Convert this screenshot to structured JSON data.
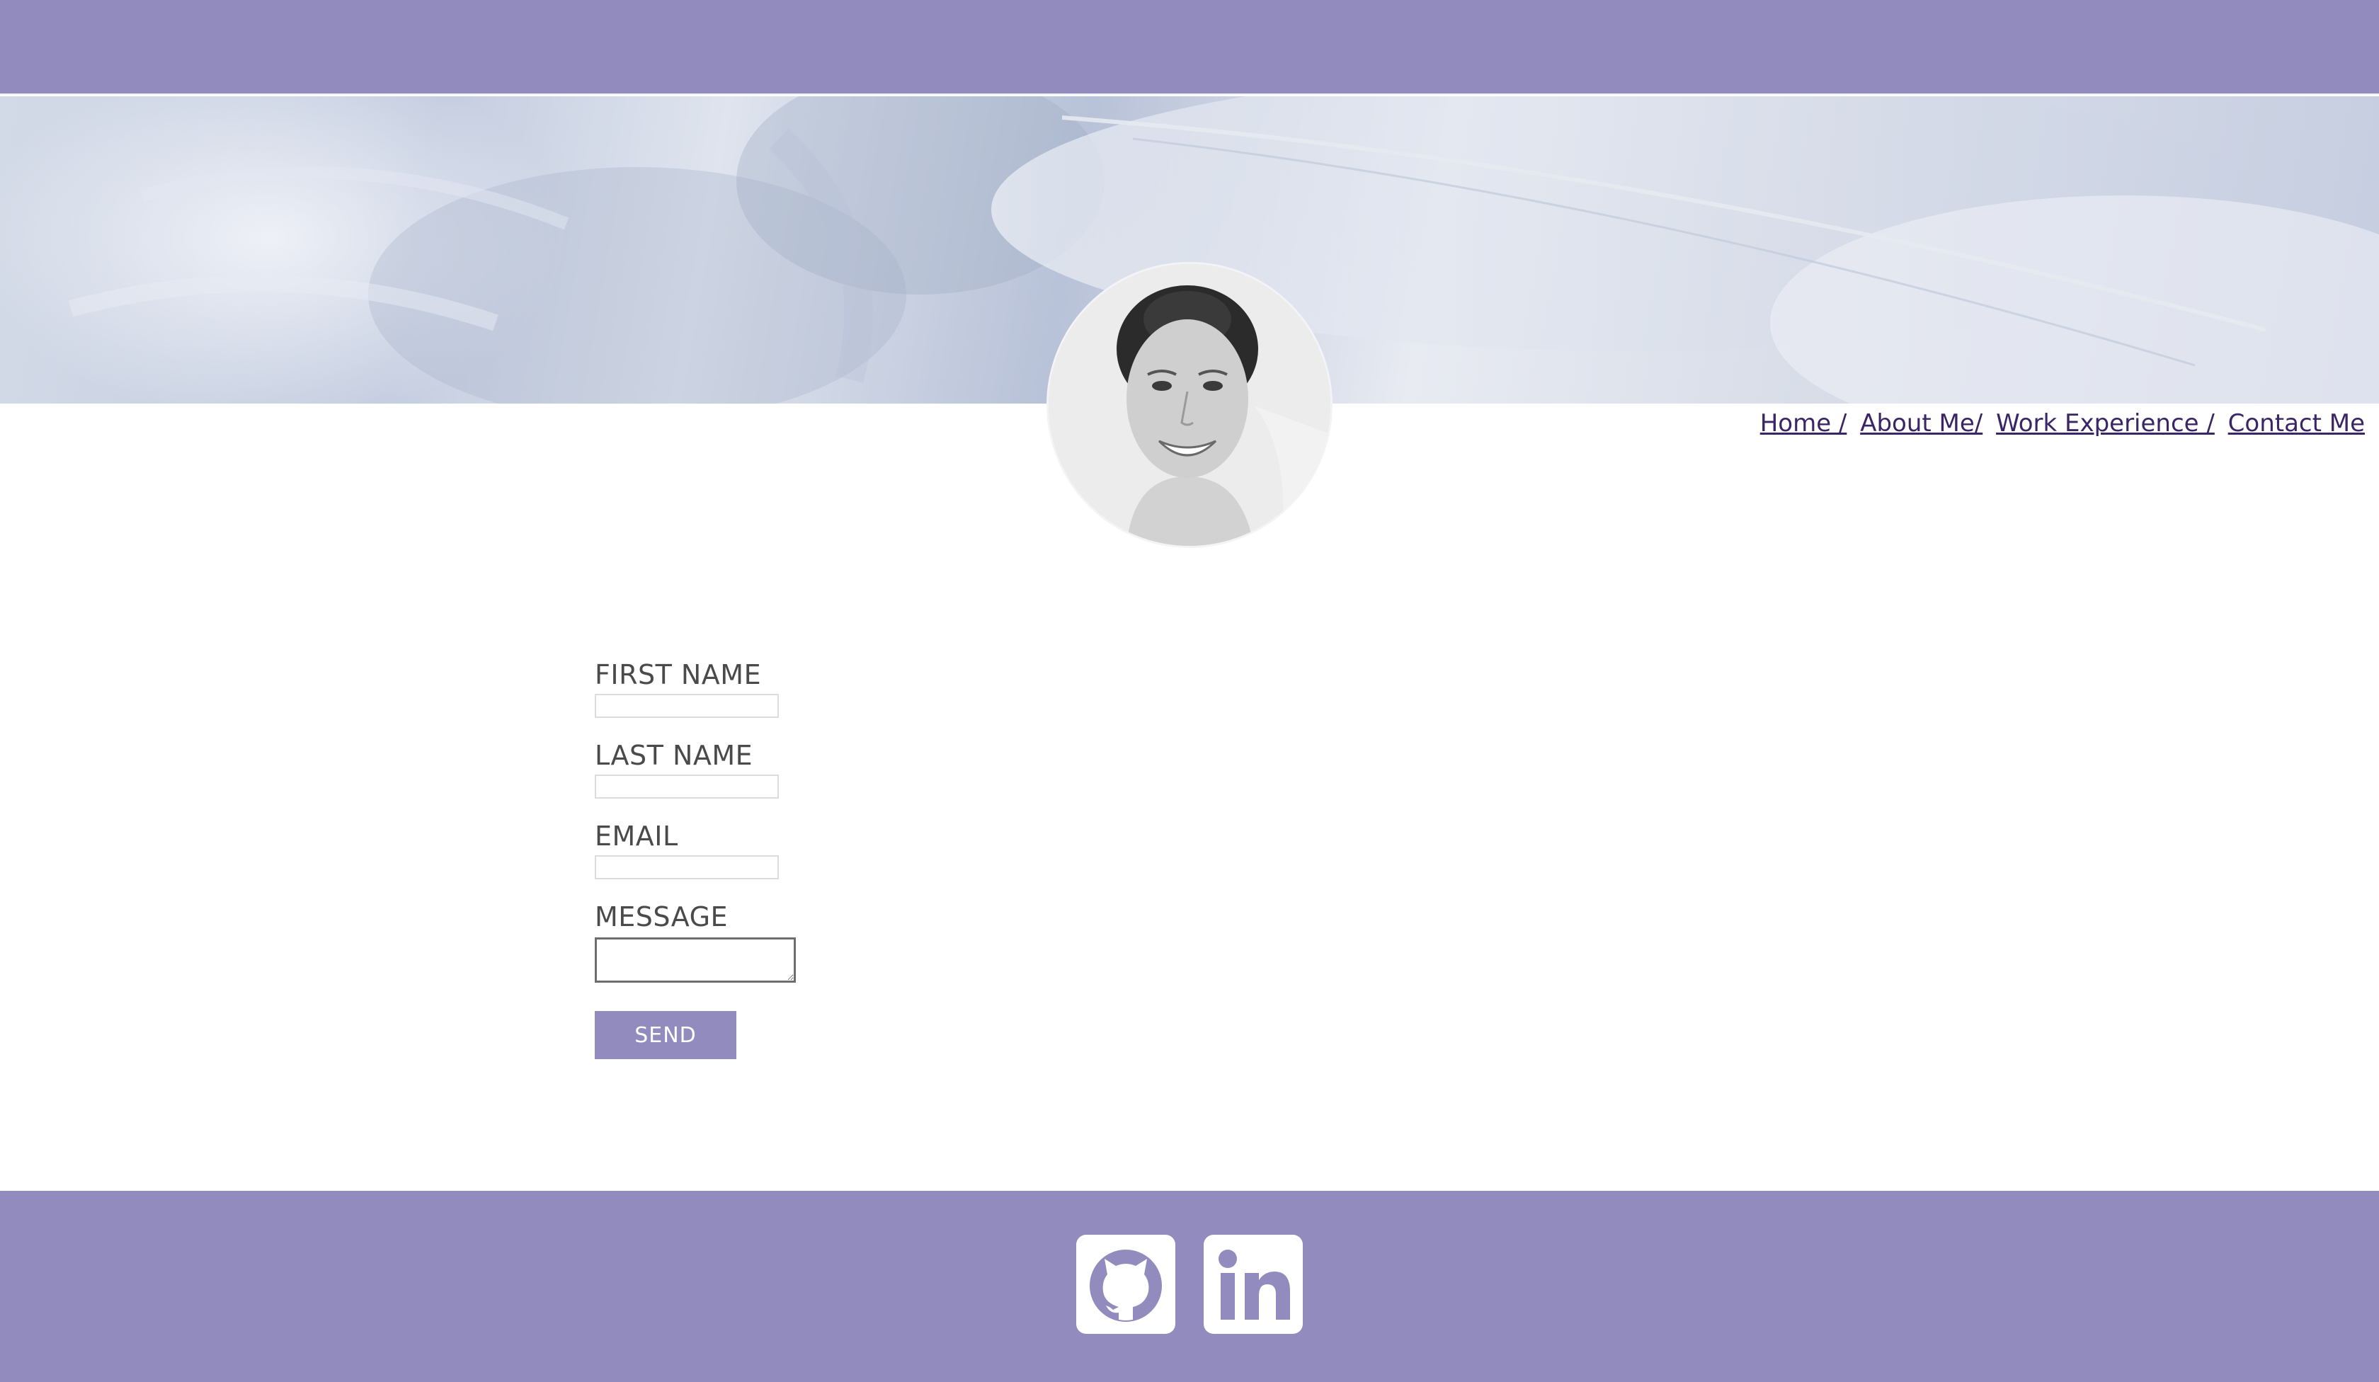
{
  "colors": {
    "accent": "#928bbe",
    "nav_link": "#3a2566",
    "label_text": "#4a4a4a",
    "page_bg": "#ffffff"
  },
  "header": {},
  "hero": {
    "image": "feather-background-image",
    "avatar": "profile-photo"
  },
  "nav": {
    "items": [
      {
        "label": "Home /"
      },
      {
        "label": "About Me/"
      },
      {
        "label": "Work Experience /"
      },
      {
        "label": "Contact Me"
      }
    ]
  },
  "form": {
    "first_name_label": "FIRST NAME",
    "first_name_value": "",
    "last_name_label": "LAST NAME",
    "last_name_value": "",
    "email_label": "EMAIL",
    "email_value": "",
    "message_label": "MESSAGE",
    "message_value": "",
    "send_label": "SEND"
  },
  "footer": {
    "social": [
      {
        "icon": "github-icon"
      },
      {
        "icon": "linkedin-icon"
      }
    ]
  }
}
